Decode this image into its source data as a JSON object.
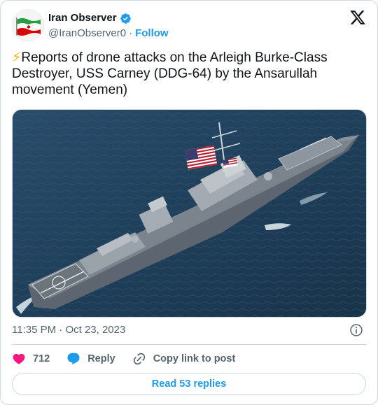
{
  "author": {
    "display_name": "Iran Observer",
    "handle": "@IranObserver0",
    "separator": "·",
    "follow_label": "Follow",
    "verified": true,
    "avatar_icon": "iran-flag-avatar"
  },
  "tweet": {
    "emoji": "⚡",
    "text": "Reports of drone attacks on the Arleigh Burke-Class Destroyer, USS Carney (DDG-64) by the Ansarullah movement (Yemen)"
  },
  "meta": {
    "time": "11:35 PM",
    "separator": "·",
    "date": "Oct 23, 2023"
  },
  "actions": {
    "like_count": "712",
    "reply_label": "Reply",
    "copy_label": "Copy link to post"
  },
  "read_replies_label": "Read 53 replies",
  "colors": {
    "accent": "#1d9bf0",
    "like": "#f91880",
    "muted": "#536471",
    "border": "#cfd9de"
  }
}
